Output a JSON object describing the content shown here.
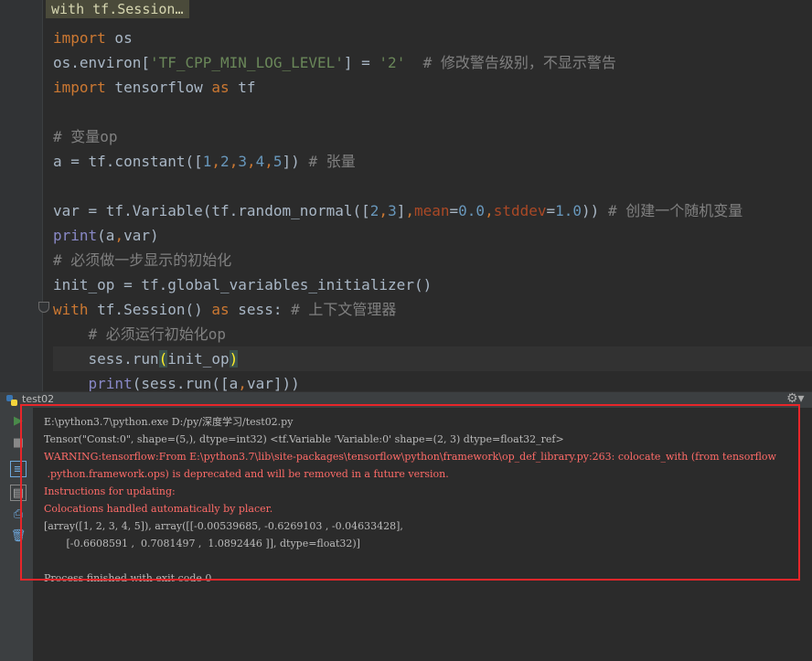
{
  "editor": {
    "breadcrumb": "with tf.Session…",
    "lines": [
      [
        {
          "t": "import",
          "c": "kw"
        },
        {
          "t": " os",
          "c": ""
        }
      ],
      [
        {
          "t": "os.environ[",
          "c": ""
        },
        {
          "t": "'TF_CPP_MIN_LOG_LEVEL'",
          "c": "str"
        },
        {
          "t": "] = ",
          "c": ""
        },
        {
          "t": "'2'",
          "c": "str"
        },
        {
          "t": "  # 修改警告级别，不显示警告",
          "c": "cmt"
        }
      ],
      [
        {
          "t": "import",
          "c": "kw"
        },
        {
          "t": " tensorflow ",
          "c": ""
        },
        {
          "t": "as",
          "c": "kw"
        },
        {
          "t": " tf",
          "c": ""
        }
      ],
      [],
      [
        {
          "t": "# 变量op",
          "c": "cmt"
        }
      ],
      [
        {
          "t": "a = tf.constant([",
          "c": ""
        },
        {
          "t": "1",
          "c": "num"
        },
        {
          "t": ",",
          "c": "kw"
        },
        {
          "t": "2",
          "c": "num"
        },
        {
          "t": ",",
          "c": "kw"
        },
        {
          "t": "3",
          "c": "num"
        },
        {
          "t": ",",
          "c": "kw"
        },
        {
          "t": "4",
          "c": "num"
        },
        {
          "t": ",",
          "c": "kw"
        },
        {
          "t": "5",
          "c": "num"
        },
        {
          "t": "]) ",
          "c": ""
        },
        {
          "t": "# 张量",
          "c": "cmt"
        }
      ],
      [],
      [
        {
          "t": "var = tf.Variable(tf.random_normal([",
          "c": ""
        },
        {
          "t": "2",
          "c": "num"
        },
        {
          "t": ",",
          "c": "kw"
        },
        {
          "t": "3",
          "c": "num"
        },
        {
          "t": "]",
          "c": ""
        },
        {
          "t": ",",
          "c": "kw"
        },
        {
          "t": "mean",
          "c": "kwarg"
        },
        {
          "t": "=",
          "c": ""
        },
        {
          "t": "0.0",
          "c": "num"
        },
        {
          "t": ",",
          "c": "kw"
        },
        {
          "t": "stddev",
          "c": "kwarg"
        },
        {
          "t": "=",
          "c": ""
        },
        {
          "t": "1.0",
          "c": "num"
        },
        {
          "t": ")) ",
          "c": ""
        },
        {
          "t": "# 创建一个随机变量",
          "c": "cmt"
        }
      ],
      [
        {
          "t": "print",
          "c": "builtin"
        },
        {
          "t": "(a",
          "c": ""
        },
        {
          "t": ",",
          "c": "kw"
        },
        {
          "t": "var)",
          "c": ""
        }
      ],
      [
        {
          "t": "# 必须做一步显示的初始化",
          "c": "cmt"
        }
      ],
      [
        {
          "t": "init_op = tf.global_variables_initializer()",
          "c": ""
        }
      ],
      [
        {
          "t": "with",
          "c": "kw"
        },
        {
          "t": " tf.Session() ",
          "c": ""
        },
        {
          "t": "as",
          "c": "kw"
        },
        {
          "t": " sess: ",
          "c": ""
        },
        {
          "t": "# 上下文管理器",
          "c": "cmt"
        }
      ],
      [
        {
          "t": "    ",
          "c": ""
        },
        {
          "t": "# 必须运行初始化op",
          "c": "cmt"
        }
      ],
      [
        {
          "t": "    sess.run",
          "c": ""
        },
        {
          "t": "(",
          "c": "bh"
        },
        {
          "t": "init_op",
          "c": ""
        },
        {
          "t": ")",
          "c": "bh"
        }
      ],
      [
        {
          "t": "    ",
          "c": ""
        },
        {
          "t": "print",
          "c": "builtin"
        },
        {
          "t": "(sess.run([a",
          "c": ""
        },
        {
          "t": ",",
          "c": "kw"
        },
        {
          "t": "var]))",
          "c": ""
        }
      ]
    ]
  },
  "run_panel": {
    "title": "test02",
    "console_lines": [
      {
        "text": "E:\\python3.7\\python.exe D:/py/深度学习/test02.py",
        "type": "normal"
      },
      {
        "text": "Tensor(\"Const:0\", shape=(5,), dtype=int32) <tf.Variable 'Variable:0' shape=(2, 3) dtype=float32_ref>",
        "type": "normal"
      },
      {
        "text": "WARNING:tensorflow:From E:\\python3.7\\lib\\site-packages\\tensorflow\\python\\framework\\op_def_library.py:263: colocate_with (from tensorflow",
        "type": "err"
      },
      {
        "text": " .python.framework.ops) is deprecated and will be removed in a future version.",
        "type": "err"
      },
      {
        "text": "Instructions for updating:",
        "type": "err"
      },
      {
        "text": "Colocations handled automatically by placer.",
        "type": "err"
      },
      {
        "text": "[array([1, 2, 3, 4, 5]), array([[-0.00539685, -0.6269103 , -0.04633428],",
        "type": "normal"
      },
      {
        "text": "       [-0.6608591 ,  0.7081497 ,  1.0892446 ]], dtype=float32)]",
        "type": "normal"
      },
      {
        "text": "",
        "type": "blank"
      },
      {
        "text": "Process finished with exit code 0",
        "type": "normal"
      }
    ]
  },
  "colors": {
    "highlight_box": "#e8262a",
    "error_text": "#ff6b68"
  }
}
